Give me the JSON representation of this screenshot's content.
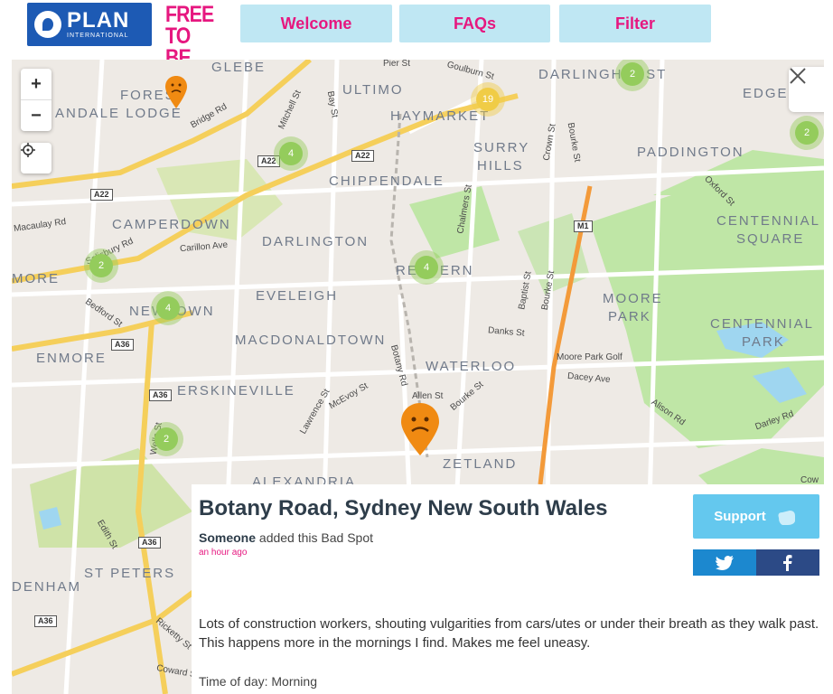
{
  "header": {
    "plan_logo_text": "PLAN",
    "plan_logo_sub": "INTERNATIONAL",
    "free_to_be_line1": "FREE",
    "free_to_be_line2": "TO BE",
    "nav": [
      {
        "label": "Welcome"
      },
      {
        "label": "FAQs"
      },
      {
        "label": "Filter"
      }
    ]
  },
  "map": {
    "zoom_in": "+",
    "zoom_out": "−",
    "places": [
      "GLEBE",
      "FOREST",
      "ANDALE LODGE",
      "ULTIMO",
      "HAYMARKET",
      "SURRY",
      "HILLS",
      "DARLINGHURST",
      "EDGECLIFF",
      "PADDINGTON",
      "CHIPPENDALE",
      "CAMPERDOWN",
      "DARLINGTON",
      "REDFERN",
      "CENTENNIAL",
      "SQUARE",
      "MORE",
      "NEWTOWN",
      "EVELEIGH",
      "MOORE",
      "PARK",
      "CENTENNIAL",
      "PARK",
      "MACDONALDTOWN",
      "ENMORE",
      "WATERLOO",
      "ERSKINEVILLE",
      "ZETLAND",
      "ALEXANDRIA",
      "ST PETERS",
      "DENHAM"
    ],
    "streets": [
      "Pier St",
      "Goulburn St",
      "Bay St",
      "Mitchell St",
      "Bridge Rd",
      "Crown St",
      "Bourke St",
      "Oxford St",
      "Chalmers St",
      "Macaulay Rd",
      "Salisbury Rd",
      "Carillon Ave",
      "Baptist St",
      "Bourke St",
      "Bedford St",
      "Danks St",
      "Botany Rd",
      "Moore Park Golf",
      "Dacey Ave",
      "Alison Rd",
      "Darley Rd",
      "Lawrence St",
      "McEvoy St",
      "Allen St",
      "Bourke St",
      "Wells St",
      "Edith St",
      "Ricketty St",
      "Coward St",
      "Cow"
    ],
    "shields": [
      "A22",
      "A22",
      "A22",
      "M1",
      "A36",
      "A36",
      "A36",
      "A36"
    ],
    "clusters": [
      {
        "count": "2",
        "color": "green"
      },
      {
        "count": "19",
        "color": "yellow"
      },
      {
        "count": "2",
        "color": "green"
      },
      {
        "count": "4",
        "color": "green"
      },
      {
        "count": "2",
        "color": "green"
      },
      {
        "count": "4",
        "color": "green"
      },
      {
        "count": "4",
        "color": "green"
      },
      {
        "count": "2",
        "color": "green"
      }
    ],
    "marker_color": "#f08a12"
  },
  "spot": {
    "title": "Botany Road, Sydney New South Wales",
    "author": "Someone",
    "action": "added this Bad Spot",
    "time_ago": "an hour ago",
    "description": "Lots of construction workers, shouting vulgarities from cars/utes or under their breath as they walk past. This happens more in the mornings I find. Makes me feel uneasy.",
    "time_of_day": "Time of day: Morning",
    "support_label": "Support"
  },
  "colors": {
    "brand_pink": "#e6177f",
    "nav_bg": "#bfe7f3",
    "support_bg": "#64c8ee",
    "twitter_bg": "#1c88cf",
    "facebook_bg": "#2c4a86"
  }
}
